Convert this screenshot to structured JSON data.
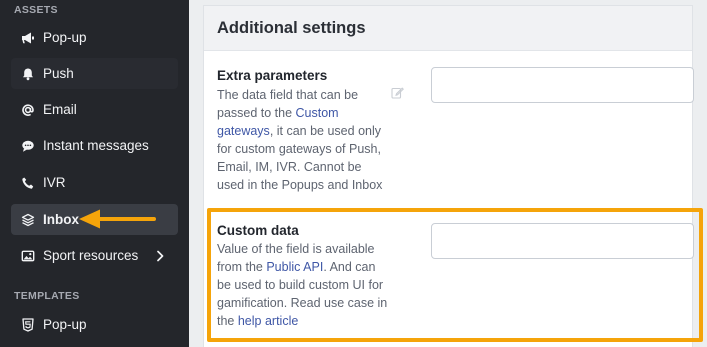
{
  "sidebar": {
    "assets_label": "ASSETS",
    "templates_label": "TEMPLATES",
    "items": [
      {
        "label": "Pop-up",
        "icon": "megaphone-icon"
      },
      {
        "label": "Push",
        "icon": "bell-icon"
      },
      {
        "label": "Email",
        "icon": "at-sign-icon"
      },
      {
        "label": "Instant messages",
        "icon": "chat-bubble-icon"
      },
      {
        "label": "IVR",
        "icon": "phone-icon"
      },
      {
        "label": "Inbox",
        "icon": "layers-icon",
        "active": true
      },
      {
        "label": "Sport resources",
        "icon": "image-icon"
      }
    ],
    "template_items": [
      {
        "label": "Pop-up",
        "icon": "html5-icon"
      }
    ]
  },
  "main": {
    "card_title": "Additional settings",
    "extra_parameters": {
      "title": "Extra parameters",
      "desc_part1": "The data field that can be passed to the ",
      "desc_link": "Custom gateways",
      "desc_part2": ", it can be used only for custom gateways of Push, Email, IM, IVR. Cannot be used in the Popups and Inbox",
      "value": "",
      "placeholder": ""
    },
    "custom_data": {
      "title": "Custom data",
      "desc_part1": "Value of the field is available from the ",
      "desc_link1": "Public API",
      "desc_part2": ". And can be used to build custom UI for gamification. Read use case in the ",
      "desc_link2": "help article",
      "value": "",
      "placeholder": ""
    }
  },
  "colors": {
    "sidebar_bg": "#24262b",
    "active_item_bg": "#3a3d44",
    "annotation": "#f5a40a",
    "link": "#3f57a6"
  }
}
